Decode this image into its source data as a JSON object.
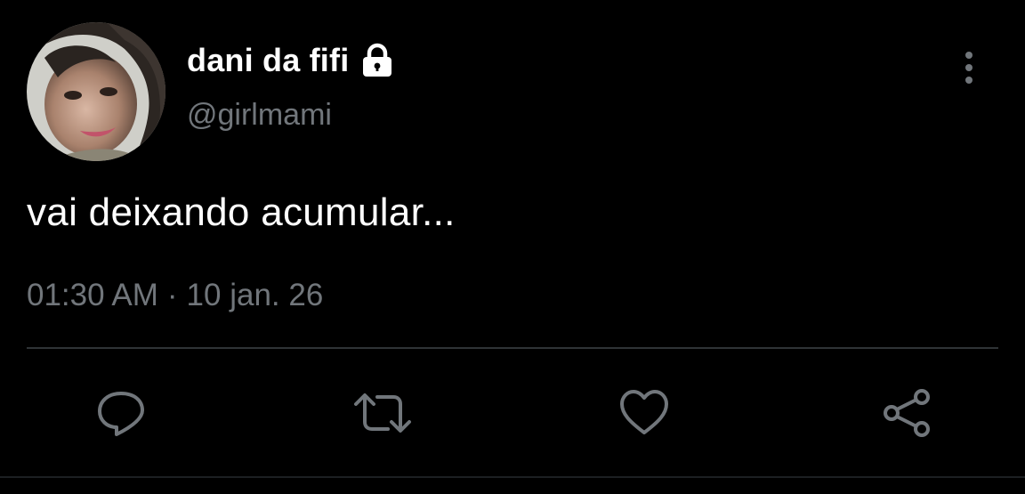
{
  "tweet": {
    "display_name": "dani da fifi",
    "handle": "@girlmami",
    "text": "vai deixando acumular...",
    "time": "01:30 AM",
    "separator": "·",
    "date": "10 jan. 26",
    "protected": true
  },
  "icons": {
    "lock": "lock-icon",
    "more": "more-vertical-icon",
    "reply": "reply-icon",
    "retweet": "retweet-icon",
    "like": "heart-icon",
    "share": "share-icon"
  },
  "colors": {
    "background": "#000000",
    "text": "#ffffff",
    "secondary": "#71767b",
    "icon": "#71767b",
    "divider": "#2f3336"
  }
}
